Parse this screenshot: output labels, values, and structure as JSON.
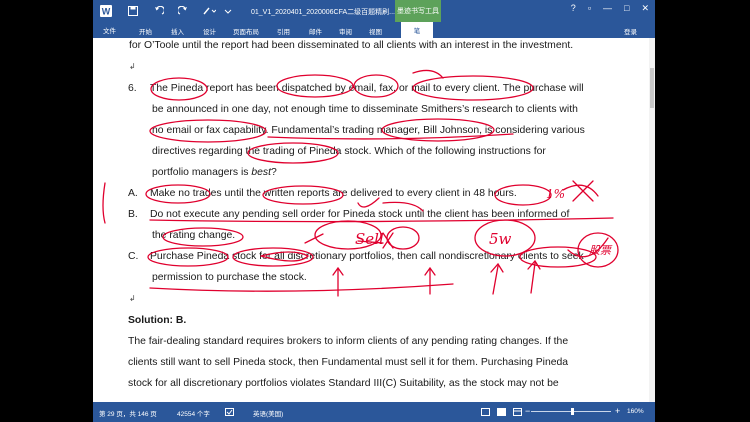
{
  "titlebar": {
    "doc_title": "01_V1_2020401_2020006CFA二级百题精刷...",
    "tool_context": "墨迹书写工具",
    "controls": [
      "?",
      "▫",
      "—",
      "□",
      "✕"
    ]
  },
  "ribbon": {
    "file_tab": "文件",
    "tabs": [
      "开始",
      "插入",
      "设计",
      "页面布局",
      "引用",
      "邮件",
      "审阅",
      "视图"
    ],
    "active_tab": "笔",
    "login": "登录"
  },
  "document": {
    "lines": [
      "for O’Toole until the report had been disseminated to all clients with an interest in the investment.",
      "6.",
      "The Pineda report has been dispatched by email, fax, or mail to every client. The purchase will",
      "be announced in one day, not enough time to disseminate Smithers’s research to clients with",
      "no email or fax capability. Fundamental’s trading manager, Bill Johnson, is considering various",
      "directives regarding the trading of Pineda stock. Which of the following instructions for",
      "portfolio managers is ",
      "best",
      "?",
      "A.",
      "Make no trades until the written reports are delivered to every client in 48 hours.",
      "B.",
      "Do not execute any pending sell order for Pineda stock until the client has been informed of",
      "the rating change.",
      "C.",
      "Purchase Pineda stock for all discretionary portfolios, then call nondiscretionary clients to seek",
      "permission to purchase the stock.",
      "Solution: B.",
      "The fair-dealing standard requires brokers to inform clients of any pending rating changes. If the",
      "clients still want to sell Pineda stock, then Fundamental must sell it for them. Purchasing Pineda",
      "stock for all discretionary portfolios violates Standard III(C) Suitability, as the stock may not be"
    ],
    "handwriting": [
      "Sell",
      "5w",
      "1%",
      "股票"
    ]
  },
  "status": {
    "page": "第 29 页，共 146 页",
    "words": "42554 个字",
    "language": "英语(美国)",
    "zoom": "160%"
  },
  "colors": {
    "accent": "#2b579a",
    "ink": "#e0002e",
    "context": "#5da25a"
  }
}
